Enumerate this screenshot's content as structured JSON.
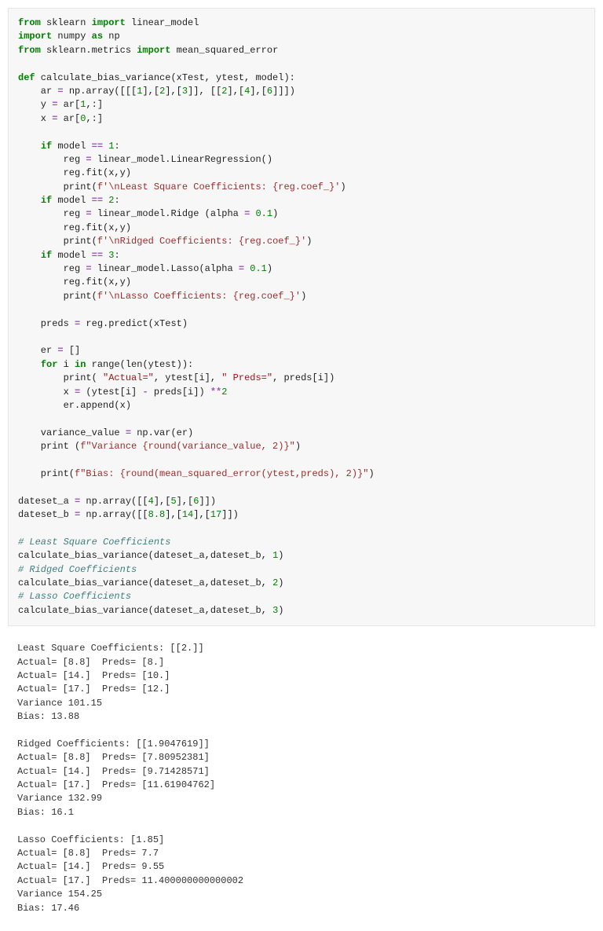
{
  "code": {
    "l1": "from",
    "l1b": " sklearn ",
    "l1c": "import",
    "l1d": " linear_model",
    "l2": "import",
    "l2b": " numpy ",
    "l2c": "as",
    "l2d": " np",
    "l3": "from",
    "l3b": " sklearn.metrics ",
    "l3c": "import",
    "l3d": " mean_squared_error",
    "blank1": "",
    "l4": "def",
    "l4b": " calculate_bias_variance(xTest, ytest, model):",
    "l5": "    ar ",
    "l5b": "=",
    "l5c": " np.array([[[",
    "l5n1": "1",
    "l5d": "],[",
    "l5n2": "2",
    "l5e": "],[",
    "l5n3": "3",
    "l5f": "]], [[",
    "l5n4": "2",
    "l5g": "],[",
    "l5n5": "4",
    "l5h": "],[",
    "l5n6": "6",
    "l5i": "]]])",
    "l6": "    y ",
    "l6b": "=",
    "l6c": " ar[",
    "l6n1": "1",
    "l6d": ",:]",
    "l7": "    x ",
    "l7b": "=",
    "l7c": " ar[",
    "l7n1": "0",
    "l7d": ",:]",
    "blank2": "",
    "l8": "    ",
    "l8a": "if",
    "l8b": " model ",
    "l8c": "==",
    "l8d": " ",
    "l8n": "1",
    "l8e": ":",
    "l9": "        reg ",
    "l9b": "=",
    "l9c": " linear_model.LinearRegression()",
    "l10": "        reg.fit(x,y)",
    "l11": "        print(",
    "l11s": "f'\\nLeast Square Coefficients: {reg.coef_}'",
    "l11e": ")",
    "l12": "    ",
    "l12a": "if",
    "l12b": " model ",
    "l12c": "==",
    "l12d": " ",
    "l12n": "2",
    "l12e": ":",
    "l13": "        reg ",
    "l13b": "=",
    "l13c": " linear_model.Ridge (alpha ",
    "l13d": "=",
    "l13e": " ",
    "l13n": "0.1",
    "l13f": ")",
    "l14": "        reg.fit(x,y)",
    "l15": "        print(",
    "l15s": "f'\\nRidged Coefficients: {reg.coef_}'",
    "l15e": ")",
    "l16": "    ",
    "l16a": "if",
    "l16b": " model ",
    "l16c": "==",
    "l16d": " ",
    "l16n": "3",
    "l16e": ":",
    "l17": "        reg ",
    "l17b": "=",
    "l17c": " linear_model.Lasso(alpha ",
    "l17d": "=",
    "l17e": " ",
    "l17n": "0.1",
    "l17f": ")",
    "l18": "        reg.fit(x,y)",
    "l19": "        print(",
    "l19s": "f'\\nLasso Coefficients: {reg.coef_}'",
    "l19e": ")",
    "blank3": "",
    "l20": "    preds ",
    "l20b": "=",
    "l20c": " reg.predict(xTest)",
    "blank4": "",
    "l21": "    er ",
    "l21b": "=",
    "l21c": " []",
    "l22": "    ",
    "l22a": "for",
    "l22b": " i ",
    "l22c": "in",
    "l22d": " range(len(ytest)):",
    "l23": "        print( ",
    "l23s1": "\"Actual=\"",
    "l23a": ", ytest[i], ",
    "l23s2": "\" Preds=\"",
    "l23b": ", preds[i])",
    "l24": "        x ",
    "l24b": "=",
    "l24c": " (ytest[i] ",
    "l24d": "-",
    "l24e": " preds[i]) ",
    "l24f": "**",
    "l24n": "2",
    "l25": "        er.append(x)",
    "blank5": "",
    "l26": "    variance_value ",
    "l26b": "=",
    "l26c": " np.var(er)",
    "l27": "    print (",
    "l27s": "f\"Variance {round(variance_value, 2)}\"",
    "l27e": ")",
    "blank6": "",
    "l28": "    print(",
    "l28s": "f\"Bias: {round(mean_squared_error(ytest,preds), 2)}\"",
    "l28e": ")",
    "blank7": "",
    "l29": "dateset_a ",
    "l29b": "=",
    "l29c": " np.array([[",
    "l29n1": "4",
    "l29d": "],[",
    "l29n2": "5",
    "l29e": "],[",
    "l29n3": "6",
    "l29f": "]])",
    "l30": "dateset_b ",
    "l30b": "=",
    "l30c": " np.array([[",
    "l30n1": "8.8",
    "l30d": "],[",
    "l30n2": "14",
    "l30e": "],[",
    "l30n3": "17",
    "l30f": "]])",
    "blank8": "",
    "c1": "# Least Square Coefficients",
    "l31": "calculate_bias_variance(dateset_a,dateset_b, ",
    "l31n": "1",
    "l31e": ")",
    "c2": "# Ridged Coefficients",
    "l32": "calculate_bias_variance(dateset_a,dateset_b, ",
    "l32n": "2",
    "l32e": ")",
    "c3": "# Lasso Coefficients",
    "l33": "calculate_bias_variance(dateset_a,dateset_b, ",
    "l33n": "3",
    "l33e": ")"
  },
  "output": {
    "o1": "Least Square Coefficients: [[2.]]",
    "o2": "Actual= [8.8]  Preds= [8.]",
    "o3": "Actual= [14.]  Preds= [10.]",
    "o4": "Actual= [17.]  Preds= [12.]",
    "o5": "Variance 101.15",
    "o6": "Bias: 13.88",
    "blank1": "",
    "o7": "Ridged Coefficients: [[1.9047619]]",
    "o8": "Actual= [8.8]  Preds= [7.80952381]",
    "o9": "Actual= [14.]  Preds= [9.71428571]",
    "o10": "Actual= [17.]  Preds= [11.61904762]",
    "o11": "Variance 132.99",
    "o12": "Bias: 16.1",
    "blank2": "",
    "o13": "Lasso Coefficients: [1.85]",
    "o14": "Actual= [8.8]  Preds= 7.7",
    "o15": "Actual= [14.]  Preds= 9.55",
    "o16": "Actual= [17.]  Preds= 11.400000000000002",
    "o17": "Variance 154.25",
    "o18": "Bias: 17.46"
  }
}
